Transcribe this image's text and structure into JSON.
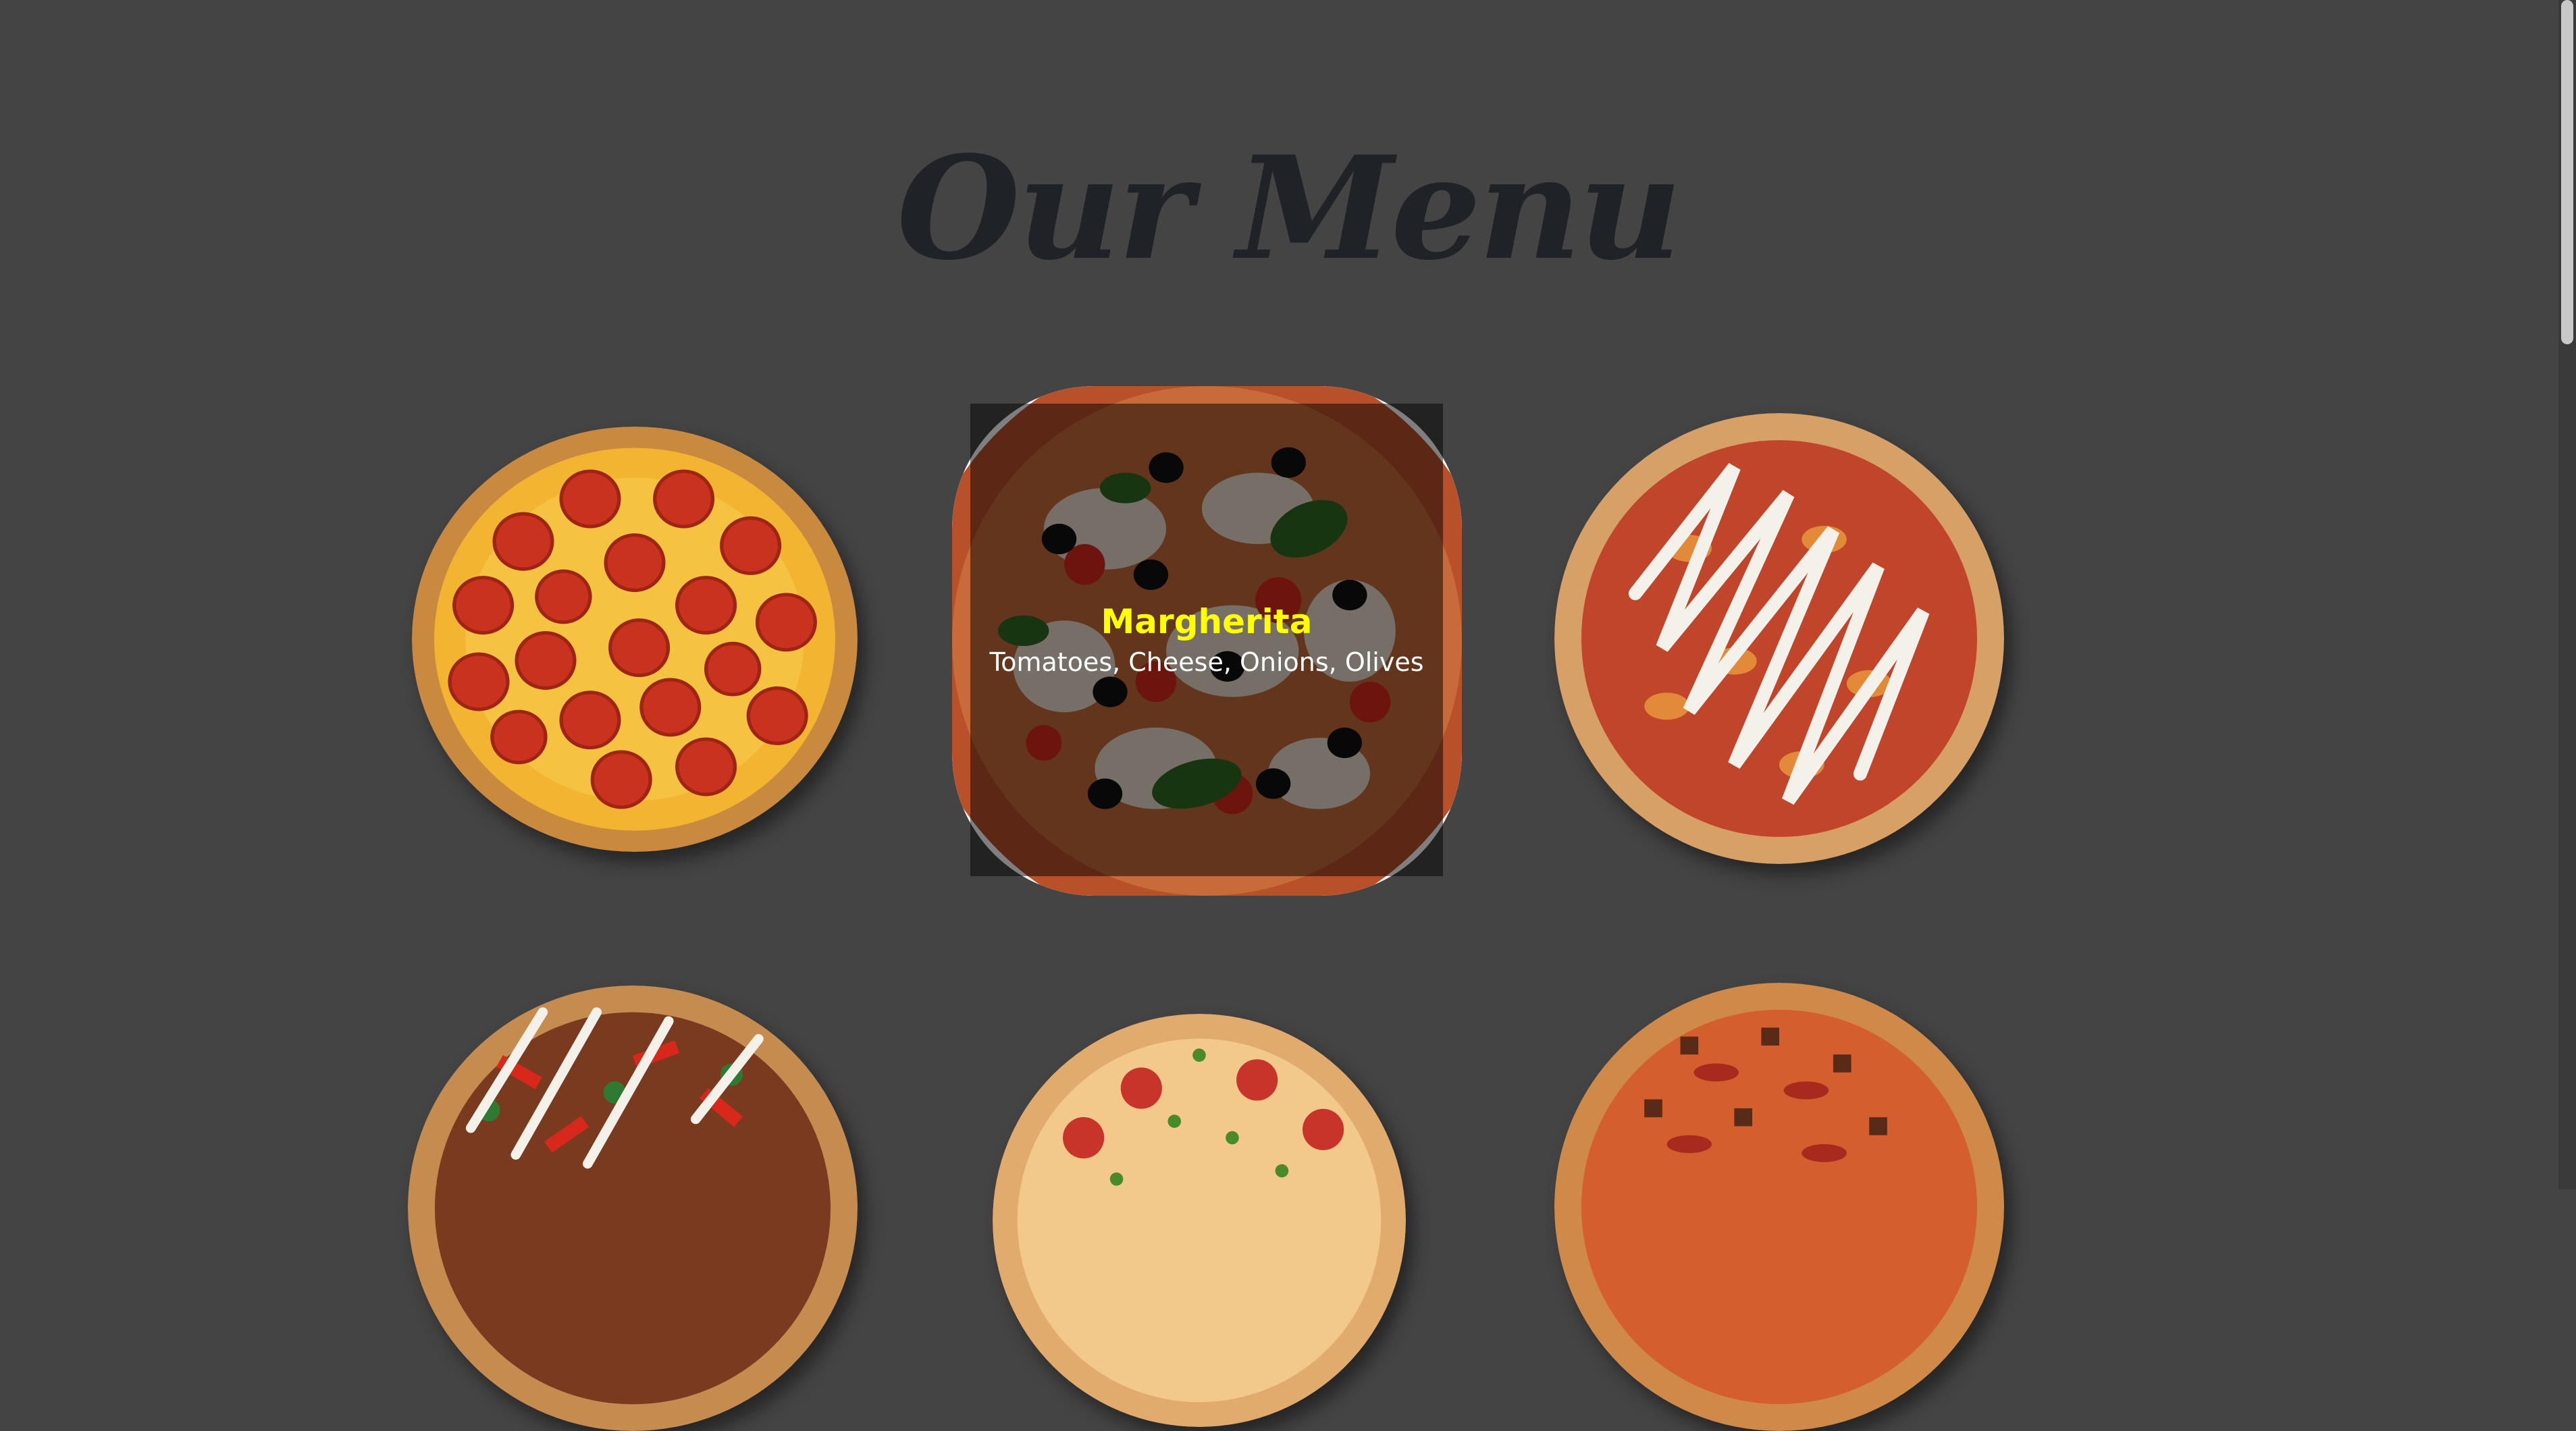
{
  "page": {
    "title": "Our Menu"
  },
  "menu": {
    "featured": {
      "name": "Margherita",
      "description": "Tomatoes, Cheese, Onions, Olives"
    },
    "items": [
      {
        "id": "pepperoni"
      },
      {
        "id": "margherita"
      },
      {
        "id": "chicken-mayo"
      },
      {
        "id": "spicy-chicken"
      },
      {
        "id": "veggie-pepperoni"
      },
      {
        "id": "meat-feast"
      }
    ]
  },
  "colors": {
    "background": "#444444",
    "title": "#1f2227",
    "overlay_name": "#ffff00",
    "overlay_desc": "#ffffff"
  }
}
